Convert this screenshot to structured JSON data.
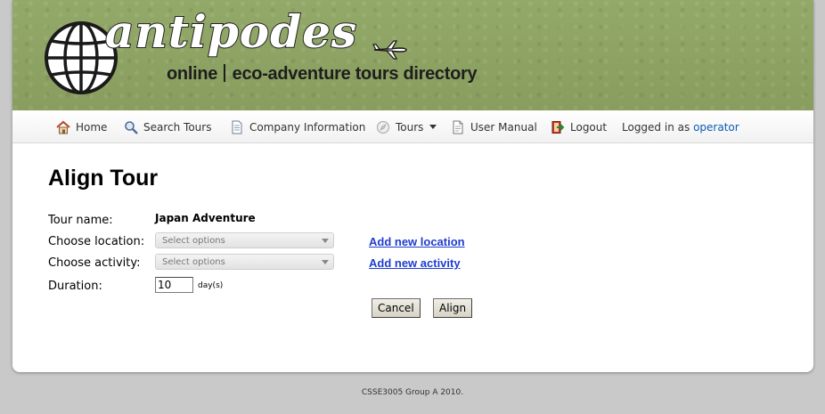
{
  "header": {
    "logo_text": "antipodes",
    "tagline_part1": "online",
    "tagline_part2": "eco-adventure tours directory"
  },
  "nav": {
    "items": [
      {
        "label": "Home",
        "icon": "house-icon"
      },
      {
        "label": "Search Tours",
        "icon": "magnifier-icon"
      },
      {
        "label": "Company Information",
        "icon": "document-icon"
      },
      {
        "label": "Tours",
        "icon": "compass-icon"
      },
      {
        "label": "User Manual",
        "icon": "manual-icon"
      },
      {
        "label": "Logout",
        "icon": "logout-icon"
      }
    ],
    "logged_in_prefix": "Logged in as",
    "username": "operator"
  },
  "form": {
    "title": "Align Tour",
    "tour_name_label": "Tour name:",
    "tour_name_value": "Japan Adventure",
    "location_label": "Choose location:",
    "location_placeholder": "Select options",
    "add_location_link": "Add new location",
    "activity_label": "Choose activity:",
    "activity_placeholder": "Select options",
    "add_activity_link": "Add new activity",
    "duration_label": "Duration:",
    "duration_value": "10",
    "duration_unit": "day(s)",
    "cancel_label": "Cancel",
    "align_label": "Align"
  },
  "footer": {
    "text": "CSSE3005 Group A 2010."
  }
}
